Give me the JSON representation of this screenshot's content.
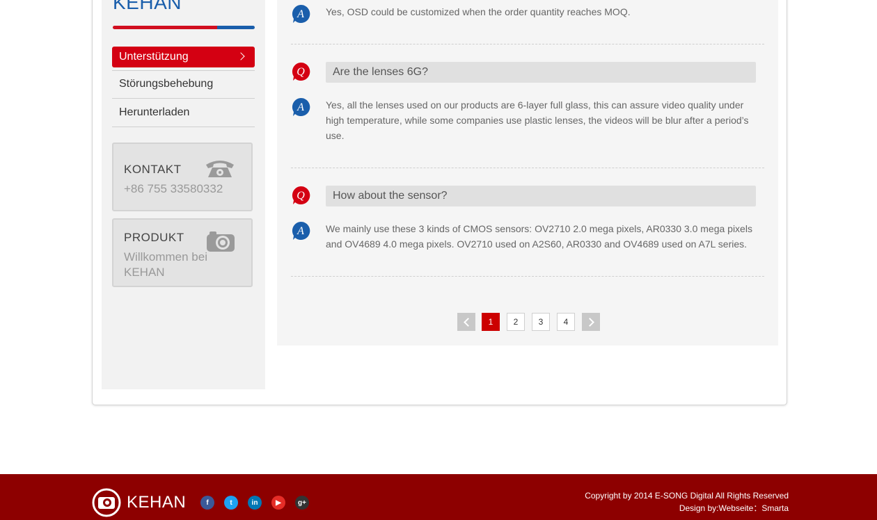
{
  "brand": {
    "title": "KEHAN"
  },
  "sidebar": {
    "items": [
      {
        "label": "Unterstützung",
        "active": true
      },
      {
        "label": "Störungsbehebung",
        "active": false
      },
      {
        "label": "Herunterladen",
        "active": false
      }
    ],
    "contact_card": {
      "title": "KONTAKT",
      "phone": "+86 755 33580332",
      "icon": "telephone-icon"
    },
    "product_card": {
      "title": "PRODUKT",
      "subtitle": "Willkommen bei KEHAN",
      "icon": "camera-icon"
    }
  },
  "faq": [
    {
      "answer": "Yes, OSD could be customized when the order quantity reaches MOQ."
    },
    {
      "question": "Are the lenses 6G?",
      "answer": "Yes, all the lenses used on our products are 6-layer full glass, this can assure video quality under high temperature, while some companies use plastic lenses, the videos will be blur after a period’s use."
    },
    {
      "question": "How about the sensor?",
      "answer": "We mainly use these 3 kinds of CMOS sensors: OV2710 2.0 mega pixels, AR0330 3.0 mega pixels and OV4689 4.0 mega pixels. OV2710 used on A2S60, AR0330 and OV4689 used on A7L series."
    }
  ],
  "badges": {
    "question": "Q",
    "answer": "A"
  },
  "pagination": {
    "pages": [
      "1",
      "2",
      "3",
      "4"
    ],
    "current": "1"
  },
  "footer": {
    "logo_text": "KEHAN",
    "social": [
      "facebook-icon",
      "twitter-icon",
      "linkedin-icon",
      "youtube-icon",
      "google-plus-icon"
    ],
    "copyright": "Copyright by 2014 E-SONG Digital All Rights Reserved",
    "design": "Design by:Webseite：Smarta"
  },
  "colors": {
    "brand_red": "#d40012",
    "brand_blue": "#1a5eab",
    "footer_bg": "#8d0000"
  }
}
